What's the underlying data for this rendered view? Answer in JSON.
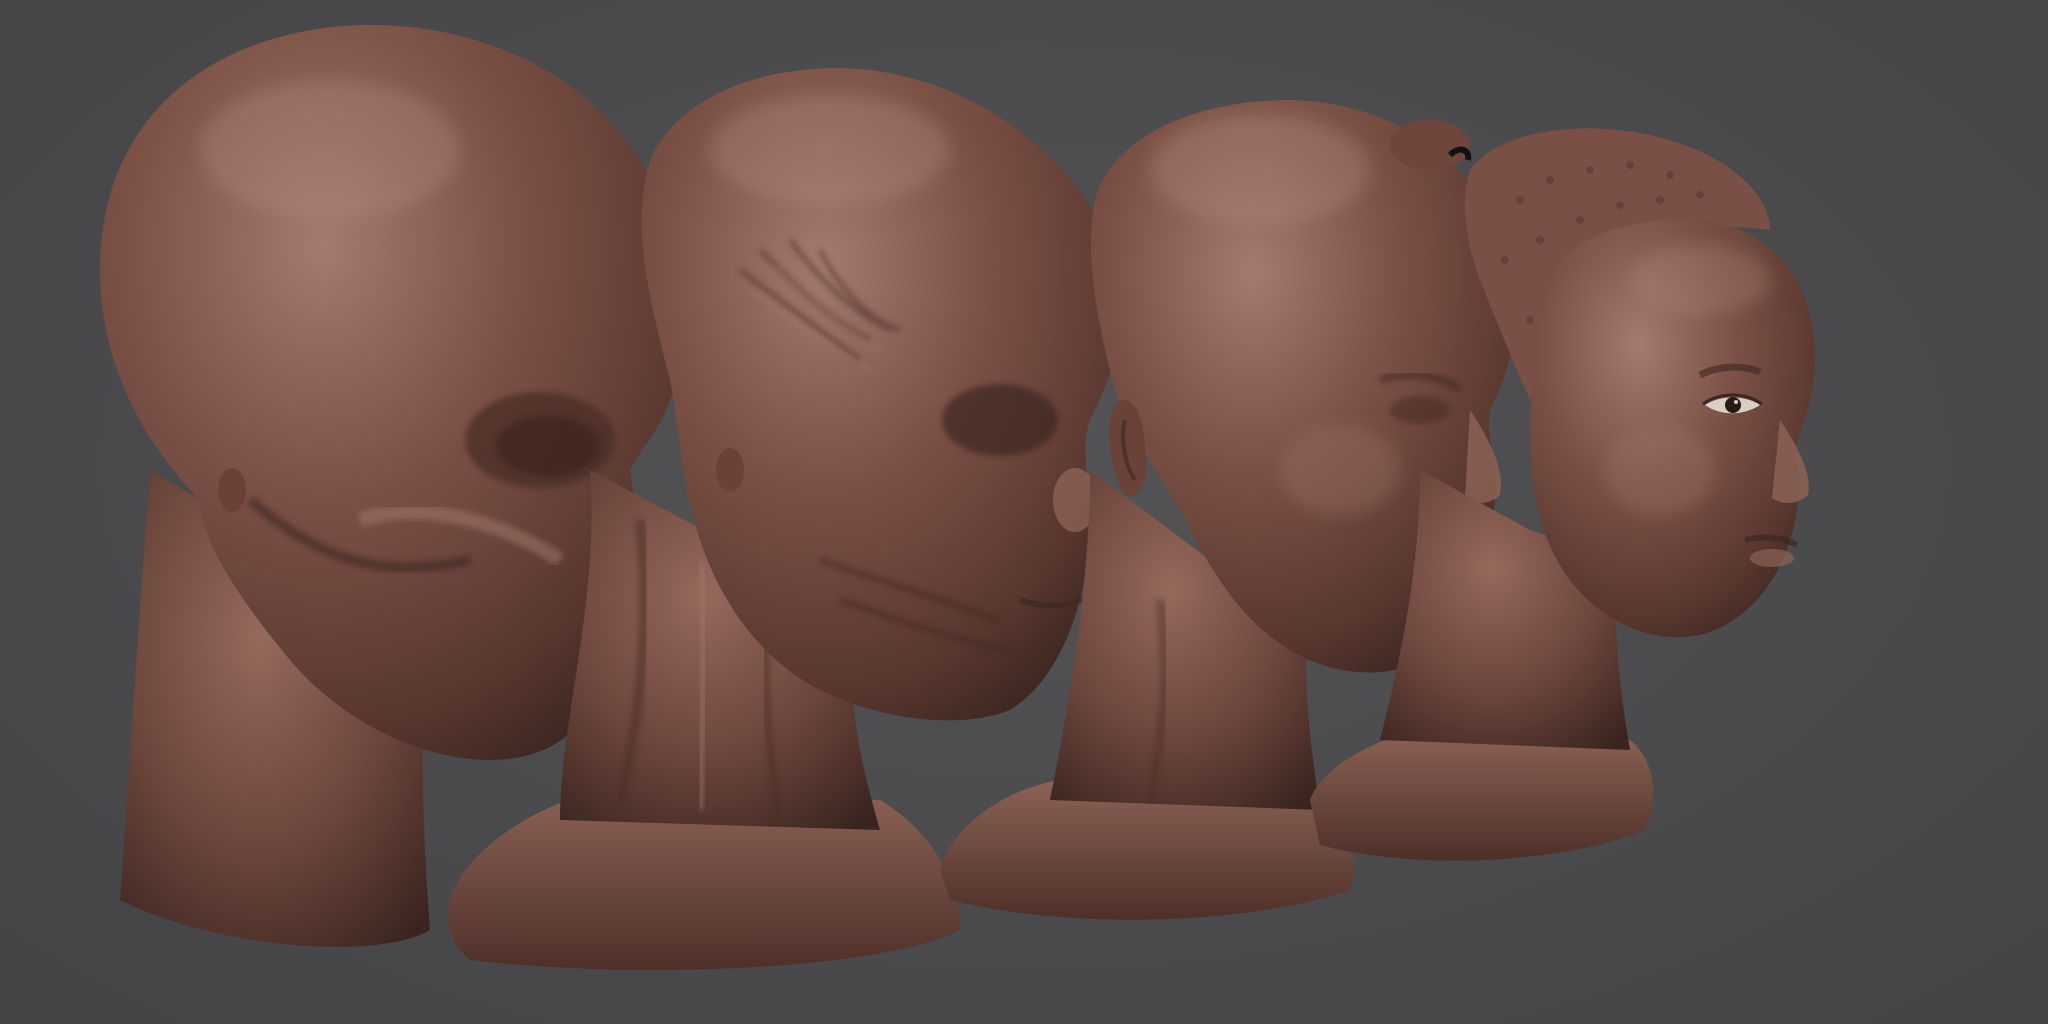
{
  "viewport": {
    "background_color": "#4b4b4d",
    "material_color": "#7a5046",
    "material_highlight": "#a47b6e",
    "material_shadow": "#3c2621",
    "eye_color": "#d8d0c6",
    "iris_color": "#2a1a14"
  },
  "models": [
    {
      "stage": "skull-base"
    },
    {
      "stage": "muscle-anatomy"
    },
    {
      "stage": "bald-skin"
    },
    {
      "stage": "detailed-with-hair"
    }
  ]
}
